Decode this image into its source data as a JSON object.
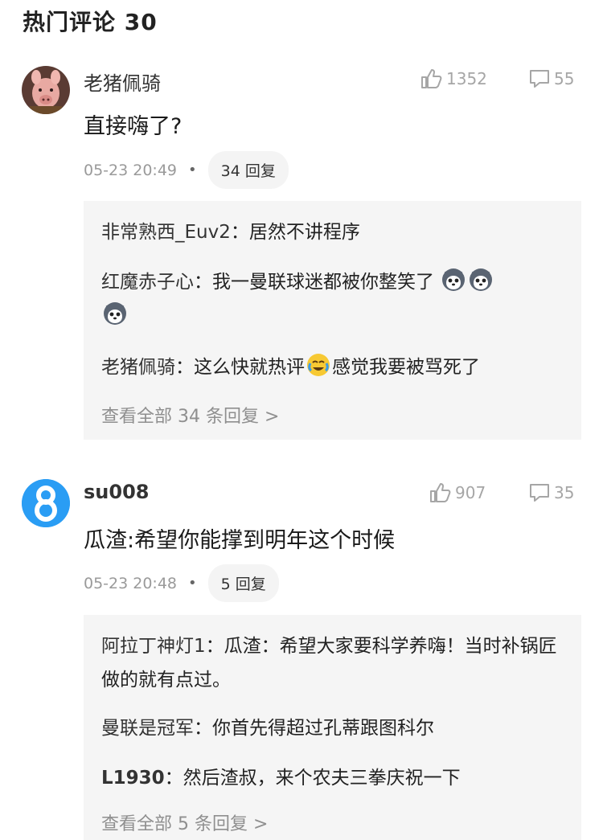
{
  "section": {
    "title": "热门评论 30"
  },
  "comments": [
    {
      "username": "老猪佩骑",
      "likes": "1352",
      "dislikes": "55",
      "text": "直接嗨了?",
      "time": "05-23 20:49",
      "reply_count": "34 回复",
      "replies": [
        {
          "author": "非常熟西_Euv2",
          "sep": "：",
          "text": "居然不讲程序"
        },
        {
          "author": "红魔赤子心",
          "sep": "：",
          "text": "我一曼联球迷都被你整笑了"
        },
        {
          "author": "老猪佩骑",
          "sep": "：",
          "text": "这么快就热评",
          "text2": "感觉我要被骂死了"
        }
      ],
      "view_all": "查看全部 34 条回复 >"
    },
    {
      "username": "su008",
      "likes": "907",
      "dislikes": "35",
      "text": "瓜渣:希望你能撑到明年这个时候",
      "time": "05-23 20:48",
      "reply_count": "5 回复",
      "replies": [
        {
          "author": "阿拉丁神灯1",
          "sep": "：",
          "text": "瓜渣：希望大家要科学养嗨！当时补锅匠做的就有点过。"
        },
        {
          "author": "曼联是冠军",
          "sep": "：",
          "text": "你首先得超过孔蒂跟图科尔"
        },
        {
          "author": "L1930",
          "sep": "：",
          "text": "然后渣叔，来个农夫三拳庆祝一下"
        }
      ],
      "view_all": "查看全部 5 条回复 >"
    }
  ],
  "icons": {
    "like": "thumbs-up-icon",
    "comment": "comment-bubble-icon",
    "emoji_husky": "husky-emoji-icon",
    "emoji_cry": "crying-laughing-emoji-icon"
  },
  "colors": {
    "stat": "#a6a6a6",
    "reply_bg": "#f5f5f5",
    "avatar_blue": "#2a9df4"
  }
}
